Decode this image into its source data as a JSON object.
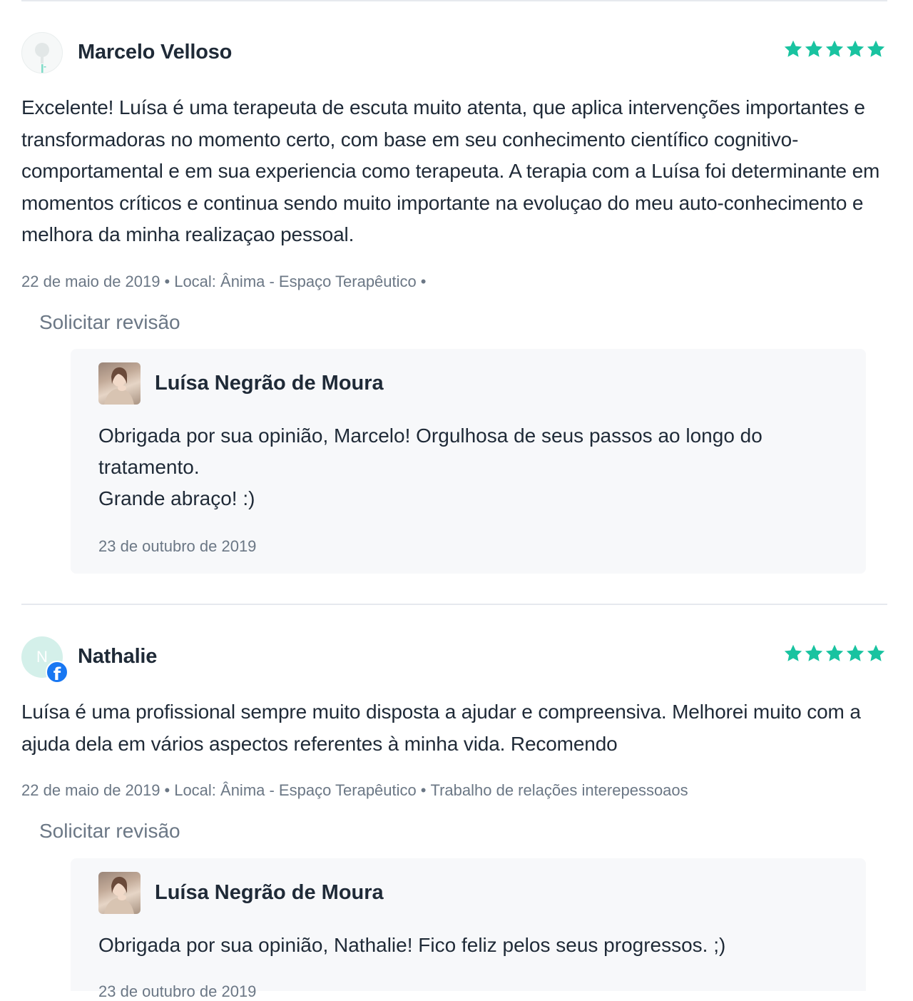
{
  "colors": {
    "star": "#19c3a0",
    "facebook": "#1877f2",
    "muted": "#6b7785",
    "text": "#1f2a37",
    "reply_bg": "#f7f8fa"
  },
  "reviews": [
    {
      "author": "Marcelo Velloso",
      "avatar_icon": "lightbulb-avatar-icon",
      "rating": 5,
      "text": "Excelente! Luísa é uma terapeuta de escuta muito atenta, que aplica intervenções importantes e transformadoras no momento certo, com base em seu conhecimento científico cognitivo-comportamental e em sua experiencia como terapeuta. A terapia com a Luísa foi determinante em momentos críticos e continua sendo muito importante na evoluçao do meu auto-conhecimento e melhora da minha realizaçao pessoal.",
      "date": "22 de maio de 2019",
      "location": "Local: Ânima - Espaço Terapêutico",
      "service": "",
      "request_review": "Solicitar revisão",
      "reply": {
        "author": "Luísa Negrão de Moura",
        "lines": [
          "Obrigada por sua opinião, Marcelo! Orgulhosa de seus passos ao longo do tratamento.",
          "Grande abraço! :)"
        ],
        "date": "23 de outubro de 2019"
      }
    },
    {
      "author": "Nathalie",
      "avatar_initial": "N",
      "avatar_badge_icon": "facebook-icon",
      "rating": 5,
      "text": "Luísa é uma profissional sempre muito disposta a ajudar e compreensiva. Melhorei muito com a ajuda dela em vários aspectos referentes à minha vida. Recomendo",
      "date": "22 de maio de 2019",
      "location": "Local: Ânima - Espaço Terapêutico",
      "service": "Trabalho de relações interepessoaos",
      "request_review": "Solicitar revisão",
      "reply": {
        "author": "Luísa Negrão de Moura",
        "lines": [
          "Obrigada por sua opinião, Nathalie! Fico feliz pelos seus progressos. ;)"
        ],
        "date": "23 de outubro de 2019"
      }
    }
  ]
}
